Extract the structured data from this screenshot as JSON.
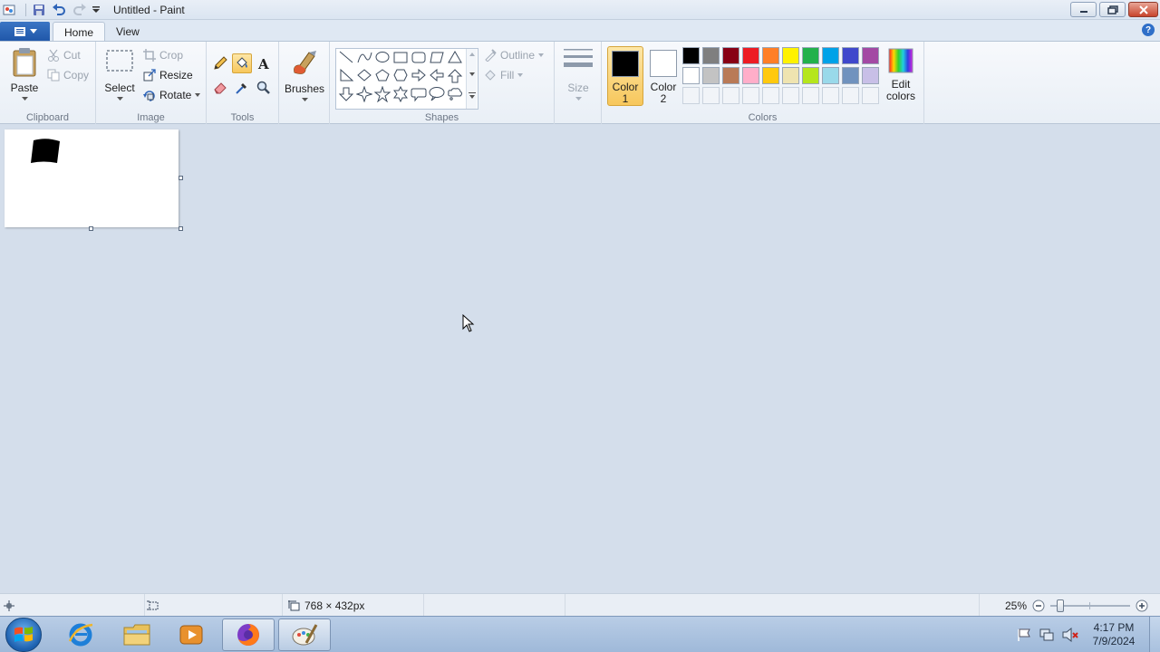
{
  "window": {
    "title": "Untitled - Paint"
  },
  "tabs": [
    {
      "label": "Home",
      "active": true
    },
    {
      "label": "View",
      "active": false
    }
  ],
  "ribbon": {
    "clipboard": {
      "label": "Clipboard",
      "paste": "Paste",
      "cut": "Cut",
      "copy": "Copy"
    },
    "image": {
      "label": "Image",
      "select": "Select",
      "crop": "Crop",
      "resize": "Resize",
      "rotate": "Rotate"
    },
    "tools": {
      "label": "Tools",
      "selected": "fill-bucket"
    },
    "brushes": {
      "label": "Brushes"
    },
    "shapes": {
      "label": "Shapes",
      "outline": "Outline",
      "fill": "Fill"
    },
    "size": {
      "label": "Size"
    },
    "colors": {
      "label": "Colors",
      "color1": {
        "label_line1": "Color",
        "label_line2": "1",
        "value": "#000000"
      },
      "color2": {
        "label_line1": "Color",
        "label_line2": "2",
        "value": "#ffffff"
      },
      "edit_label_line1": "Edit",
      "edit_label_line2": "colors",
      "palette_row1": [
        "#000000",
        "#7f7f7f",
        "#880015",
        "#ed1c24",
        "#ff7f27",
        "#fff200",
        "#22b14c",
        "#00a2e8",
        "#3f48cc",
        "#a349a4"
      ],
      "palette_row2": [
        "#ffffff",
        "#c3c3c3",
        "#b97a57",
        "#ffaec9",
        "#ffc90e",
        "#efe4b0",
        "#b5e61d",
        "#99d9ea",
        "#7092be",
        "#c8bfe7"
      ],
      "custom_slots": 10
    }
  },
  "status_bar": {
    "canvas_size": "768 × 432px",
    "zoom": "25%",
    "zoom_fraction": 0.25
  },
  "taskbar": {
    "apps": [
      "internet-explorer",
      "file-explorer",
      "media-player",
      "firefox",
      "paint"
    ],
    "active_app": "paint",
    "time": "4:17 PM",
    "date": "7/9/2024"
  }
}
